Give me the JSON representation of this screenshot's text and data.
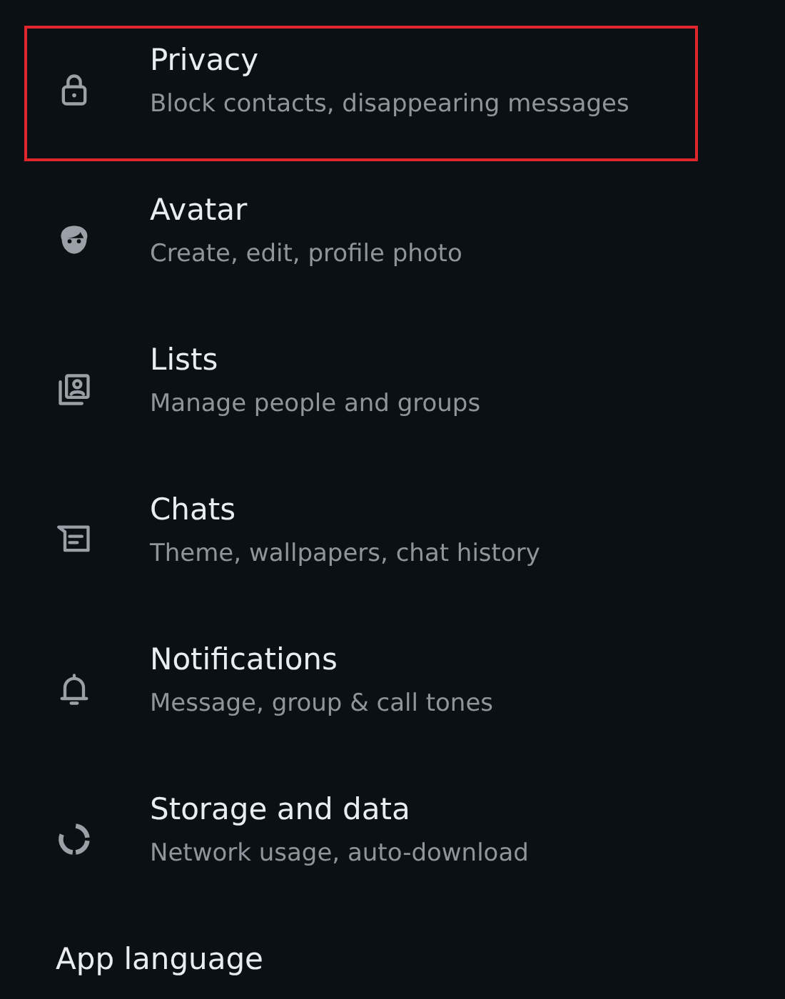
{
  "settings": [
    {
      "kind": "privacy",
      "title": "Privacy",
      "subtitle": "Block contacts, disappearing messages",
      "highlighted": true
    },
    {
      "kind": "avatar",
      "title": "Avatar",
      "subtitle": "Create, edit, profile photo",
      "highlighted": false
    },
    {
      "kind": "lists",
      "title": "Lists",
      "subtitle": "Manage people and groups",
      "highlighted": false
    },
    {
      "kind": "chats",
      "title": "Chats",
      "subtitle": "Theme, wallpapers, chat history",
      "highlighted": false
    },
    {
      "kind": "notifications",
      "title": "Notifications",
      "subtitle": "Message, group & call tones",
      "highlighted": false
    },
    {
      "kind": "storage",
      "title": "Storage and data",
      "subtitle": "Network usage, auto-download",
      "highlighted": false
    },
    {
      "kind": "language",
      "title": "App language",
      "highlighted": false
    }
  ]
}
